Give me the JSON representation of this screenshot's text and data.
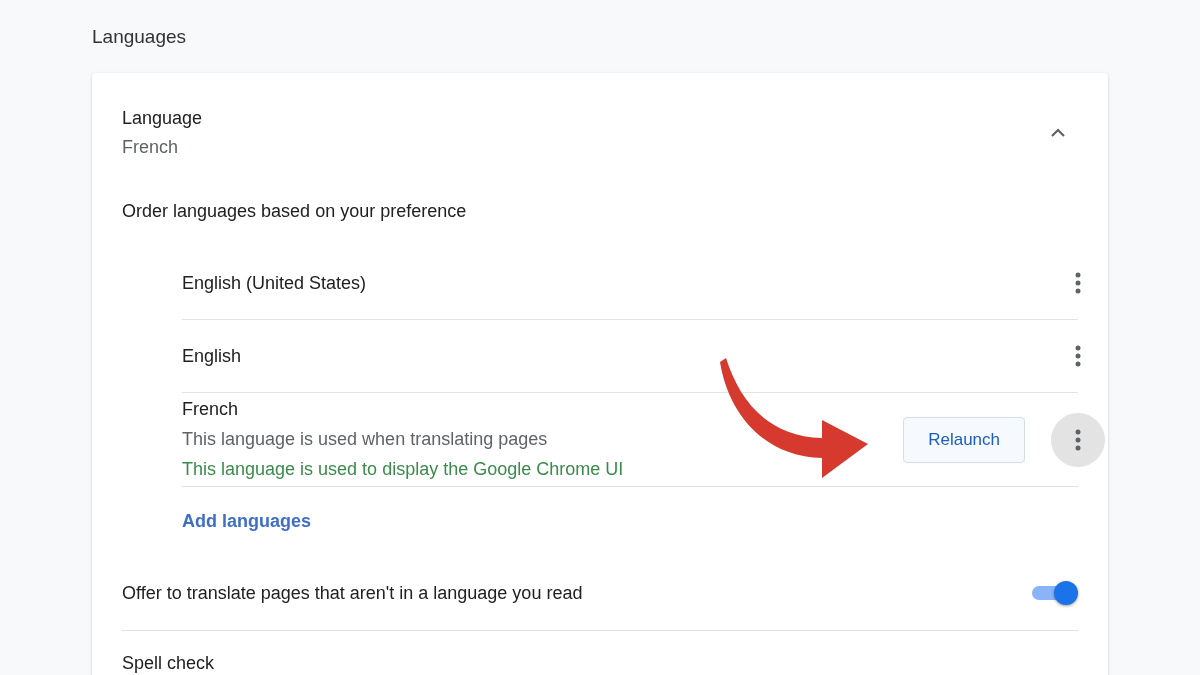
{
  "section_title": "Languages",
  "language": {
    "label": "Language",
    "value": "French",
    "expanded": true
  },
  "order_label": "Order languages based on your preference",
  "languages": [
    {
      "name": "English (United States)",
      "focused": false
    },
    {
      "name": "English",
      "focused": false
    },
    {
      "name": "French",
      "focused": true,
      "notes": [
        {
          "text": "This language is used when translating pages",
          "kind": "info"
        },
        {
          "text": "This language is used to display the Google Chrome UI",
          "kind": "ui"
        }
      ],
      "button": "Relaunch"
    }
  ],
  "add_link": "Add languages",
  "translate": {
    "label": "Offer to translate pages that aren't in a language you read",
    "on": true
  },
  "spell_check": {
    "label": "Spell check"
  }
}
